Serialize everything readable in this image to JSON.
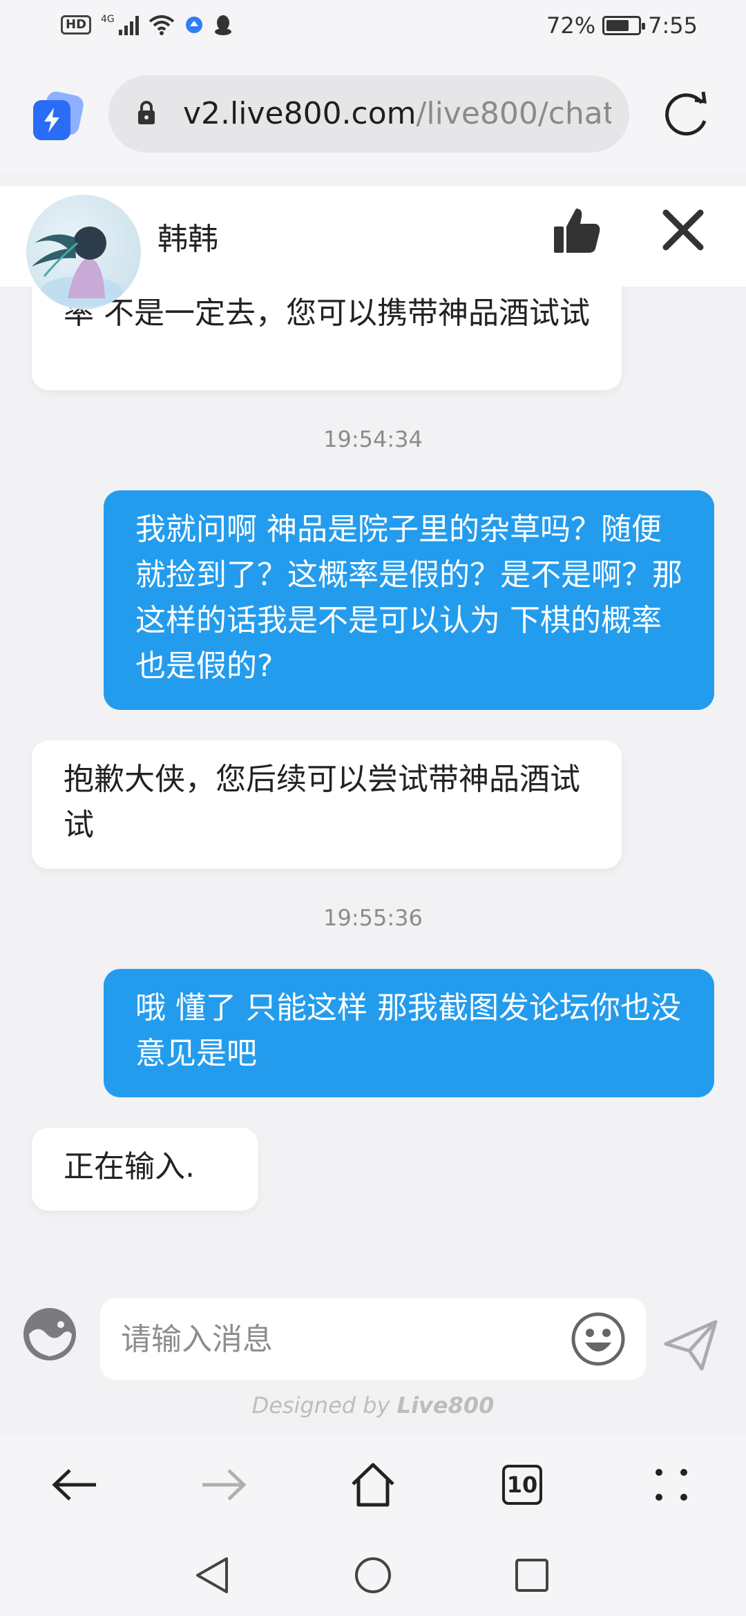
{
  "status_bar": {
    "hd": "HD",
    "network": "4G",
    "battery": "72%",
    "battery_level": 0.72,
    "time": "7:55"
  },
  "browser": {
    "url_host": "v2.live800.com",
    "url_path": "/live800/chat("
  },
  "chat_header": {
    "agent_name": "韩韩"
  },
  "messages": [
    {
      "side": "left",
      "text": "率 不是一定去，您可以携带神品酒试试"
    },
    {
      "type": "timestamp",
      "text": "19:54:34"
    },
    {
      "side": "right",
      "text": "我就问啊 神品是院子里的杂草吗？随便就捡到了？这概率是假的？是不是啊？那这样的话我是不是可以认为 下棋的概率也是假的?"
    },
    {
      "side": "left",
      "text": "抱歉大侠，您后续可以尝试带神品酒试试"
    },
    {
      "type": "timestamp",
      "text": "19:55:36"
    },
    {
      "side": "right",
      "text": "哦 懂了 只能这样 那我截图发论坛你也没意见是吧"
    },
    {
      "side": "left",
      "text": "正在输入."
    }
  ],
  "input": {
    "placeholder": "请输入消息"
  },
  "footer": {
    "designed_prefix": "Designed by ",
    "designed_brand": "Live800"
  },
  "bottom_nav": {
    "tab_count": "10"
  },
  "colors": {
    "accent": "#249ced",
    "app_logo": "#2a6cf5"
  }
}
